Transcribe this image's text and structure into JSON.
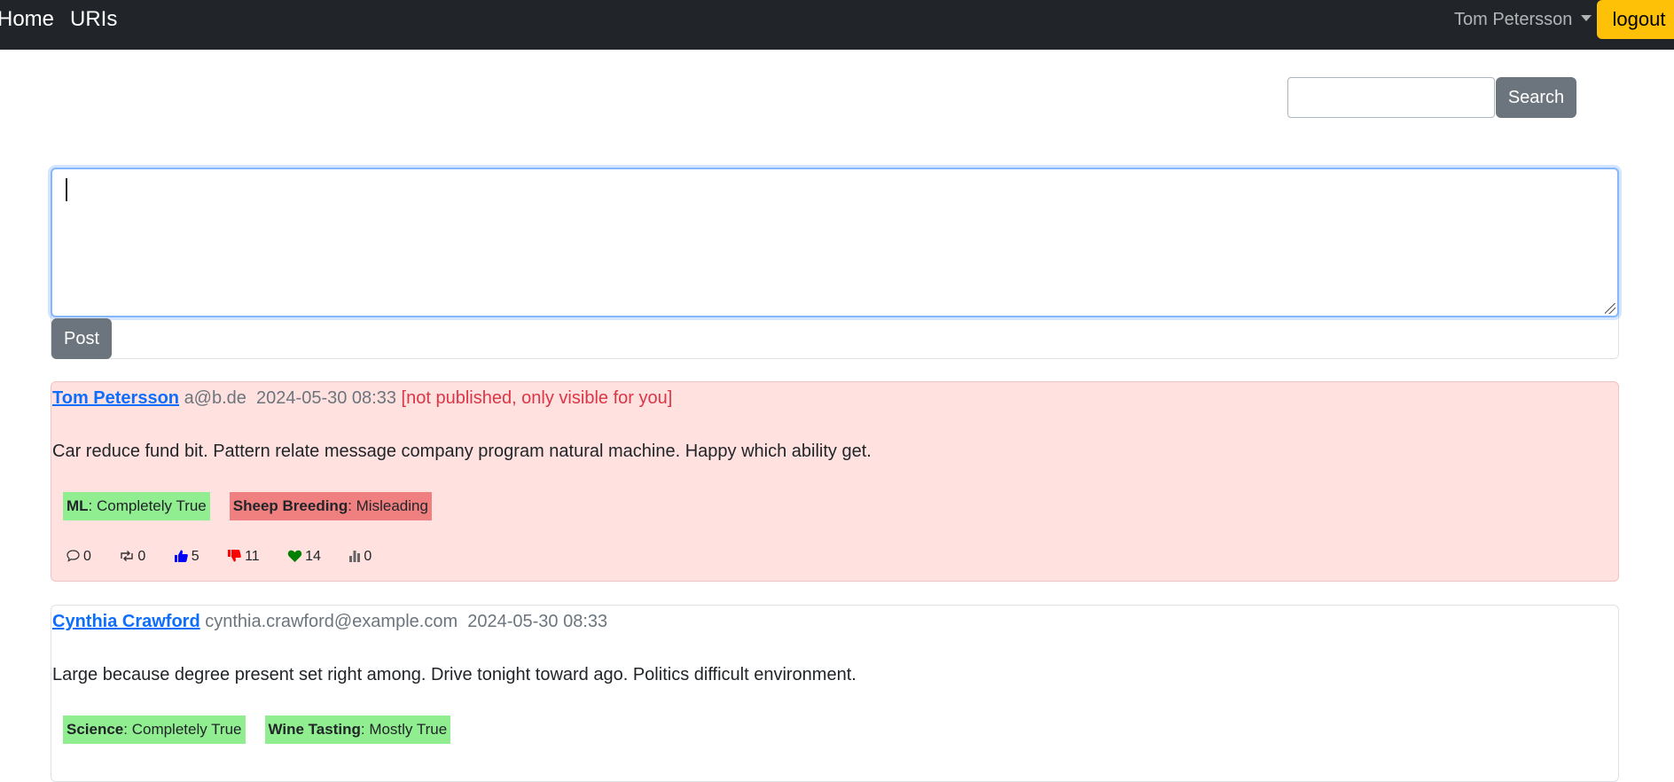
{
  "navbar": {
    "home_label": "Home",
    "uris_label": "URIs",
    "user_name": "Tom Petersson",
    "logout_label": "logout"
  },
  "search": {
    "value": "",
    "button_label": "Search"
  },
  "compose": {
    "text": "",
    "post_label": "Post"
  },
  "posts": [
    {
      "author": "Tom Petersson",
      "email": "a@b.de",
      "timestamp": "2024-05-30 08:33",
      "note": "[not published, only visible for you]",
      "body": "Car reduce fund bit. Pattern relate message company program natural machine. Happy which ability get.",
      "tags": [
        {
          "topic": "ML",
          "rating": ": Completely True",
          "color": "#90ee90"
        },
        {
          "topic": "Sheep Breeding",
          "rating": ": Misleading",
          "color": "#f08080"
        }
      ],
      "stats": {
        "comments": "0",
        "reposts": "0",
        "likes": "5",
        "dislikes": "11",
        "hearts": "14",
        "views": "0"
      }
    },
    {
      "author": "Cynthia Crawford",
      "email": "cynthia.crawford@example.com",
      "timestamp": "2024-05-30 08:33",
      "body": "Large because degree present set right among. Drive tonight toward ago. Politics difficult environment.",
      "tags": [
        {
          "topic": "Science",
          "rating": ": Completely True",
          "color": "#90ee90"
        },
        {
          "topic": "Wine Tasting",
          "rating": ": Mostly True",
          "color": "#90ee90"
        }
      ]
    }
  ],
  "colors": {
    "navbar_bg": "#212529",
    "logout_bg": "#ffc107",
    "unpublished_card_bg": "#ffe1e0",
    "link": "#0d6efd",
    "unpublished_text": "#dc3545",
    "tag_true": "#90ee90",
    "tag_misleading": "#f08080",
    "like_icon": "#0000ff",
    "dislike_icon": "#ff0000",
    "heart_icon": "#008000"
  },
  "icons": [
    "comment-icon",
    "repost-icon",
    "thumbs-up-icon",
    "thumbs-down-icon",
    "heart-icon",
    "bar-chart-icon"
  ]
}
